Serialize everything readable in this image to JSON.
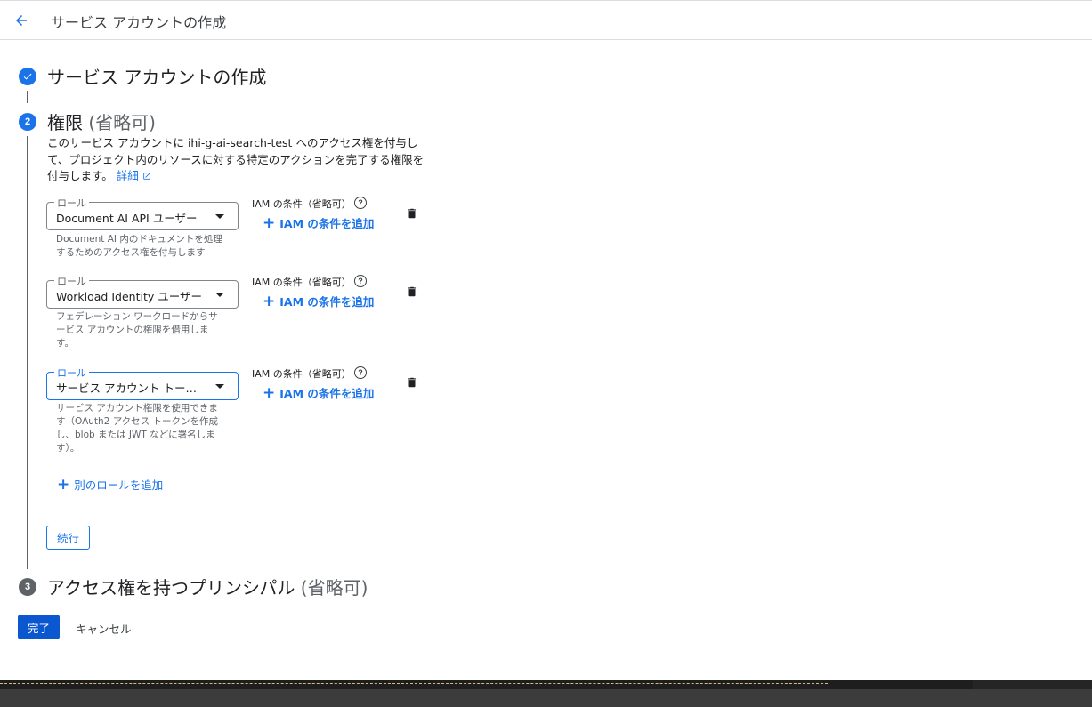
{
  "header": {
    "title": "サービス アカウントの作成"
  },
  "steps": [
    {
      "number": "✓",
      "title": "サービス アカウントの作成",
      "optional": ""
    },
    {
      "number": "2",
      "title": "権限",
      "optional": "(省略可)"
    },
    {
      "number": "3",
      "title": "アクセス権を持つプリンシパル",
      "optional": "(省略可)"
    }
  ],
  "permissions": {
    "description_part1": "このサービス アカウントに ",
    "account_name": "ihi-g-ai-search-test",
    "description_part2": " へのアクセス権を付与して、プロジェクト内のリソースに対する特定のアクションを完了する権限を付与します。",
    "details_link": "詳細",
    "roles": [
      {
        "legend": "ロール",
        "value": "Document AI API ユーザー",
        "help": "Document AI 内のドキュメントを処理するためのアクセス権を付与します",
        "condition_label": "IAM の条件（省略可）",
        "add_condition": "IAM の条件を追加"
      },
      {
        "legend": "ロール",
        "value": "Workload Identity ユーザー",
        "help": "フェデレーション ワークロードからサービス アカウントの権限を借用します。",
        "condition_label": "IAM の条件（省略可）",
        "add_condition": "IAM の条件を追加"
      },
      {
        "legend": "ロール",
        "value": "サービス アカウント トークン作成者",
        "help": "サービス アカウント権限を使用できます（OAuth2 アクセス トークンを作成し、blob または JWT などに署名します）。",
        "condition_label": "IAM の条件（省略可）",
        "add_condition": "IAM の条件を追加"
      }
    ],
    "add_role": "別のロールを追加",
    "continue": "続行"
  },
  "actions": {
    "done": "完了",
    "cancel": "キャンセル"
  },
  "icons": {
    "back": "arrow-back-icon",
    "help": "help-circle-icon",
    "delete": "trash-icon",
    "external": "open-in-new-icon"
  },
  "colors": {
    "accent": "#1a73e8",
    "primary_button": "#0b57d0"
  }
}
